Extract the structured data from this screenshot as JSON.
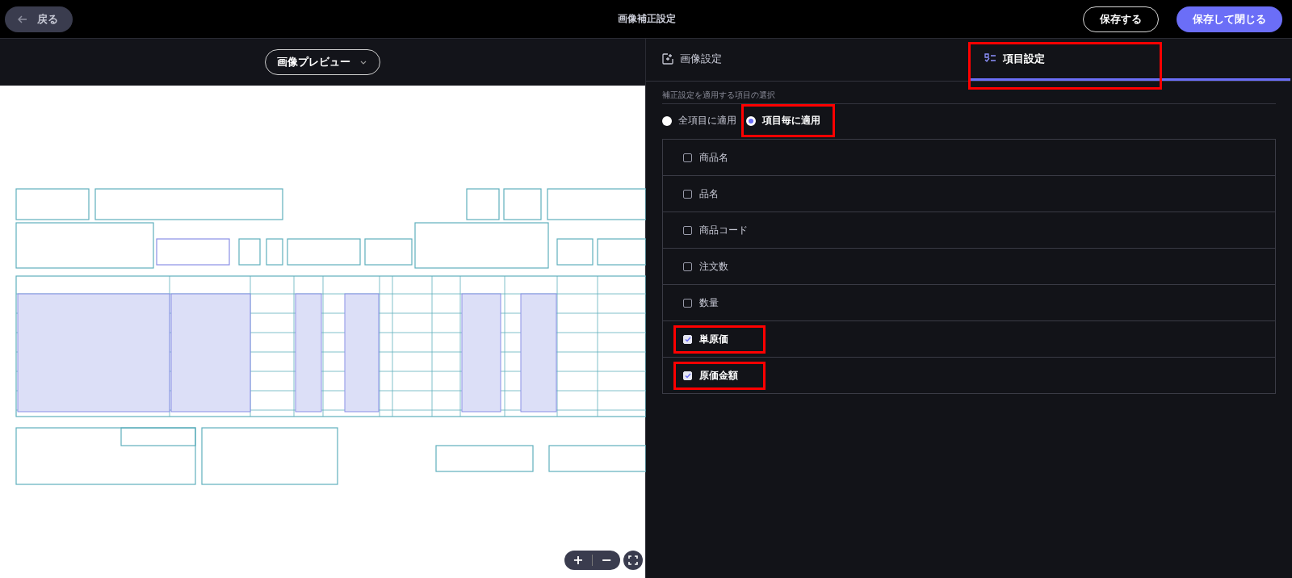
{
  "top_bar": {
    "back_button": "戻る",
    "title": "画像補正設定",
    "save_button": "保存する",
    "save_close_button": "保存して閉じる"
  },
  "preview": {
    "view_select": "画像プレビュー",
    "zoom_in": "+",
    "zoom_out": "−"
  },
  "settings": {
    "tabs": [
      {
        "label": "画像設定",
        "kind": "image",
        "selected": false,
        "highlighted": false
      },
      {
        "label": "項目設定",
        "kind": "list",
        "selected": true,
        "highlighted": true
      }
    ],
    "section_label": "補正設定を適用する項目の選択",
    "scope_options": [
      {
        "label": "全項目に適用",
        "selected": false,
        "highlighted": false
      },
      {
        "label": "項目毎に適用",
        "selected": true,
        "highlighted": true
      }
    ],
    "items": [
      {
        "label": "商品名",
        "checked": false,
        "highlighted": false
      },
      {
        "label": "品名",
        "checked": false,
        "highlighted": false
      },
      {
        "label": "商品コード",
        "checked": false,
        "highlighted": false
      },
      {
        "label": "注文数",
        "checked": false,
        "highlighted": false
      },
      {
        "label": "数量",
        "checked": false,
        "highlighted": false
      },
      {
        "label": "単原価",
        "checked": true,
        "highlighted": true
      },
      {
        "label": "原価金額",
        "checked": true,
        "highlighted": true
      }
    ]
  }
}
